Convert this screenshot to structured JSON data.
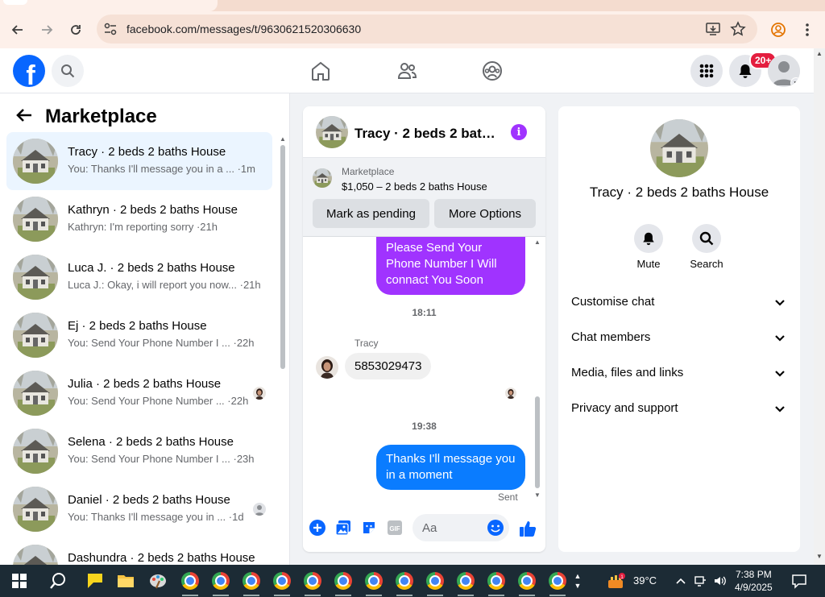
{
  "browser": {
    "url": "facebook.com/messages/t/9630621520306630"
  },
  "header": {
    "notifications_badge": "20+"
  },
  "left_panel": {
    "title": "Marketplace",
    "conversations": [
      {
        "name": "Tracy · 2 beds 2 baths House",
        "preview": "You: Thanks I'll message you in a ... ·1m",
        "active": true
      },
      {
        "name": "Kathryn · 2 beds 2 baths House",
        "preview": "Kathryn: I'm reporting sorry ·21h"
      },
      {
        "name": "Luca J. · 2 beds 2 baths House",
        "preview": "Luca J.: Okay, i will report you now... ·21h"
      },
      {
        "name": "Ej · 2 beds 2 baths House",
        "preview": "You: Send Your Phone Number I ...  ·22h"
      },
      {
        "name": "Julia · 2 beds 2 baths House",
        "preview": "You: Send Your Phone Number ... ·22h"
      },
      {
        "name": "Selena · 2 beds 2 baths House",
        "preview": "You: Send Your Phone Number I ... ·23h"
      },
      {
        "name": "Daniel · 2 beds 2 baths House",
        "preview": "You: Thanks I'll message you in ... ·1d"
      },
      {
        "name": "Dashundra · 2 beds 2 baths House",
        "preview": ""
      }
    ]
  },
  "chat": {
    "title": "Tracy · 2 beds 2 baths House",
    "listing_label": "Marketplace",
    "listing_price": "$1,050 – 2 beds 2 baths House",
    "mark_pending": "Mark as pending",
    "more_options": "More Options",
    "messages": {
      "out1": "Please Send Your Phone Number I Will connact You Soon",
      "time1": "18:11",
      "sender": "Tracy",
      "in1": "5853029473",
      "time2": "19:38",
      "out2": "Thanks I'll message you in a moment",
      "status": "Sent"
    },
    "composer_placeholder": "Aa"
  },
  "right_panel": {
    "name": "Tracy · 2 beds 2 baths House",
    "mute_label": "Mute",
    "search_label": "Search",
    "sections": [
      "Customise chat",
      "Chat members",
      "Media, files and links",
      "Privacy and support"
    ]
  },
  "taskbar": {
    "weather": "39°C",
    "time": "7:38 PM",
    "date": "4/9/2025"
  },
  "colors": {
    "facebook_blue": "#0866ff",
    "outgoing_purple": "#a033ff",
    "outgoing_blue": "#0a7cff",
    "badge_red": "#e41e3f"
  }
}
